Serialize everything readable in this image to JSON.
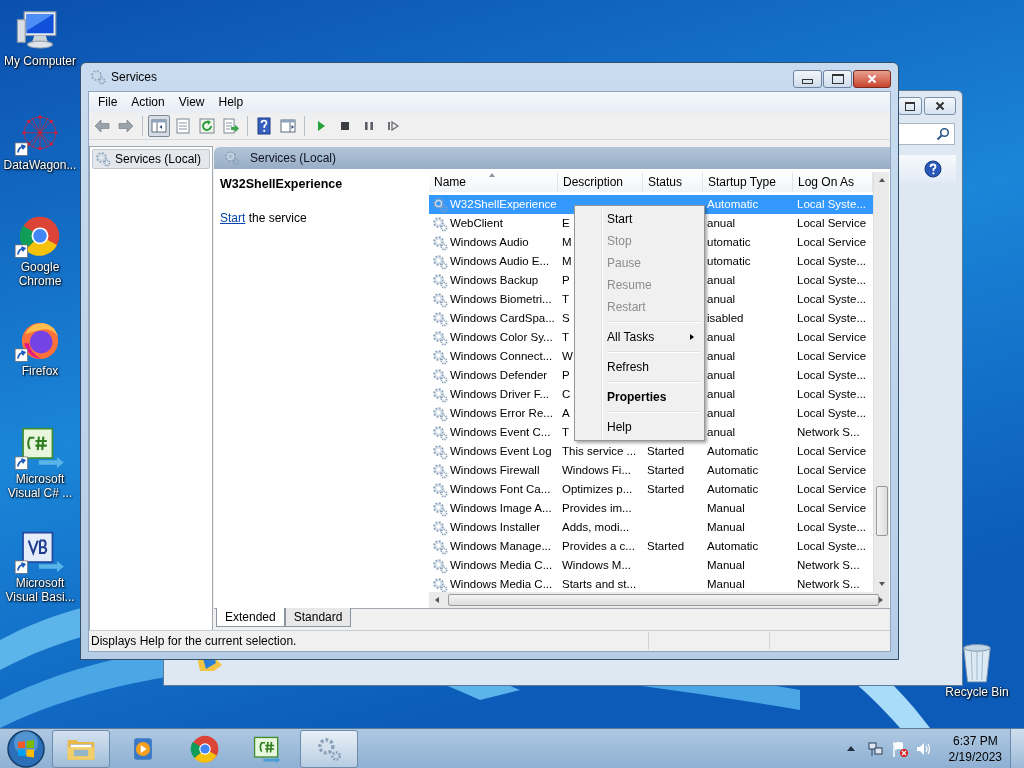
{
  "desktop_icons": [
    {
      "label": "My Computer",
      "kind": "computer",
      "shortcut": false
    },
    {
      "label": "DataWagon...",
      "kind": "network",
      "shortcut": true
    },
    {
      "label": "Google Chrome",
      "kind": "chrome",
      "shortcut": true
    },
    {
      "label": "Firefox",
      "kind": "firefox",
      "shortcut": true
    },
    {
      "label": "Microsoft Visual C# ...",
      "kind": "csharp",
      "shortcut": true
    },
    {
      "label": "Microsoft Visual Basi...",
      "kind": "vb",
      "shortcut": true
    }
  ],
  "recycle_bin": {
    "label": "Recycle Bin"
  },
  "window": {
    "title": "Services",
    "menu": [
      "File",
      "Action",
      "View",
      "Help"
    ],
    "toolbar": [
      {
        "kind": "back",
        "pressed": false
      },
      {
        "kind": "forward",
        "pressed": false
      },
      {
        "kind": "separator"
      },
      {
        "kind": "tree",
        "pressed": true
      },
      {
        "kind": "properties",
        "pressed": false
      },
      {
        "kind": "refresh",
        "pressed": false
      },
      {
        "kind": "export",
        "pressed": false
      },
      {
        "kind": "separator"
      },
      {
        "kind": "help",
        "pressed": false
      },
      {
        "kind": "pane",
        "pressed": false
      },
      {
        "kind": "separator"
      },
      {
        "kind": "play",
        "pressed": false
      },
      {
        "kind": "stop",
        "pressed": false
      },
      {
        "kind": "pause",
        "pressed": false
      },
      {
        "kind": "resume",
        "pressed": false
      }
    ],
    "tree": [
      {
        "label": "Services (Local)",
        "selected": true
      }
    ],
    "header": "Services (Local)",
    "details": {
      "service_name": "W32ShellExperience",
      "action_link": "Start",
      "action_text": "the service"
    },
    "table": {
      "columns": [
        "Name",
        "Description",
        "Status",
        "Startup Type",
        "Log On As"
      ],
      "rows": [
        {
          "name": "W32ShellExperience",
          "startup_type": "Automatic",
          "log_on_as": "Local Syste...",
          "selected": true
        },
        {
          "name": "WebClient",
          "description": "E",
          "startup_type": "anual",
          "log_on_as": "Local Service",
          "selected": false
        },
        {
          "name": "Windows Audio",
          "description": "M",
          "startup_type": "utomatic",
          "log_on_as": "Local Service",
          "selected": false
        },
        {
          "name": "Windows Audio E...",
          "description": "M",
          "startup_type": "utomatic",
          "log_on_as": "Local Syste...",
          "selected": false
        },
        {
          "name": "Windows Backup",
          "description": "P",
          "startup_type": "anual",
          "log_on_as": "Local Syste...",
          "selected": false
        },
        {
          "name": "Windows Biometri...",
          "description": "T",
          "startup_type": "anual",
          "log_on_as": "Local Syste...",
          "selected": false
        },
        {
          "name": "Windows CardSpa...",
          "description": "S",
          "startup_type": "isabled",
          "log_on_as": "Local Syste...",
          "selected": false
        },
        {
          "name": "Windows Color Sy...",
          "description": "T",
          "startup_type": "anual",
          "log_on_as": "Local Service",
          "selected": false
        },
        {
          "name": "Windows Connect...",
          "description": "W",
          "startup_type": "anual",
          "log_on_as": "Local Service",
          "selected": false
        },
        {
          "name": "Windows Defender",
          "description": "P",
          "startup_type": "anual",
          "log_on_as": "Local Syste...",
          "selected": false
        },
        {
          "name": "Windows Driver F...",
          "description": "C",
          "startup_type": "anual",
          "log_on_as": "Local Syste...",
          "selected": false
        },
        {
          "name": "Windows Error Re...",
          "description": "A",
          "startup_type": "anual",
          "log_on_as": "Local Syste...",
          "selected": false
        },
        {
          "name": "Windows Event C...",
          "description": "T",
          "startup_type": "anual",
          "log_on_as": "Network S...",
          "selected": false
        },
        {
          "name": "Windows Event Log",
          "description": "This service ...",
          "status": "Started",
          "startup_type": "Automatic",
          "log_on_as": "Local Service",
          "selected": false
        },
        {
          "name": "Windows Firewall",
          "description": "Windows Fi...",
          "status": "Started",
          "startup_type": "Automatic",
          "log_on_as": "Local Service",
          "selected": false
        },
        {
          "name": "Windows Font Ca...",
          "description": "Optimizes p...",
          "status": "Started",
          "startup_type": "Automatic",
          "log_on_as": "Local Service",
          "selected": false
        },
        {
          "name": "Windows Image A...",
          "description": "Provides im...",
          "startup_type": "Manual",
          "log_on_as": "Local Service",
          "selected": false
        },
        {
          "name": "Windows Installer",
          "description": "Adds, modi...",
          "startup_type": "Manual",
          "log_on_as": "Local Syste...",
          "selected": false
        },
        {
          "name": "Windows Manage...",
          "description": "Provides a c...",
          "status": "Started",
          "startup_type": "Automatic",
          "log_on_as": "Local Syste...",
          "selected": false
        },
        {
          "name": "Windows Media C...",
          "description": "Windows M...",
          "startup_type": "Manual",
          "log_on_as": "Network S...",
          "selected": false
        },
        {
          "name": "Windows Media C...",
          "description": "Starts and st...",
          "startup_type": "Manual",
          "log_on_as": "Network S...",
          "selected": false
        }
      ]
    },
    "view_tabs": [
      {
        "label": "Extended",
        "selected": true
      },
      {
        "label": "Standard",
        "selected": false
      }
    ],
    "status_bar": "Displays Help for the current selection."
  },
  "context_menu": {
    "items": [
      {
        "kind": "item",
        "label": "Start",
        "disabled": false
      },
      {
        "kind": "item",
        "label": "Stop",
        "disabled": true
      },
      {
        "kind": "item",
        "label": "Pause",
        "disabled": true
      },
      {
        "kind": "item",
        "label": "Resume",
        "disabled": true
      },
      {
        "kind": "item",
        "label": "Restart",
        "disabled": true
      },
      {
        "kind": "separator"
      },
      {
        "kind": "submenu",
        "label": "All Tasks",
        "disabled": false
      },
      {
        "kind": "separator"
      },
      {
        "kind": "item",
        "label": "Refresh",
        "disabled": false
      },
      {
        "kind": "separator"
      },
      {
        "kind": "default",
        "label": "Properties",
        "disabled": false
      },
      {
        "kind": "separator"
      },
      {
        "kind": "item",
        "label": "Help",
        "disabled": false
      }
    ]
  },
  "taskbar": {
    "apps": [
      {
        "kind": "explorer",
        "active": false,
        "framed": true
      },
      {
        "kind": "media",
        "active": false,
        "framed": false
      },
      {
        "kind": "chrome",
        "active": false,
        "framed": false
      },
      {
        "kind": "csharp",
        "active": false,
        "framed": false
      },
      {
        "kind": "services",
        "active": true,
        "framed": true
      }
    ],
    "time": "6:37 PM",
    "date": "2/19/2023"
  }
}
